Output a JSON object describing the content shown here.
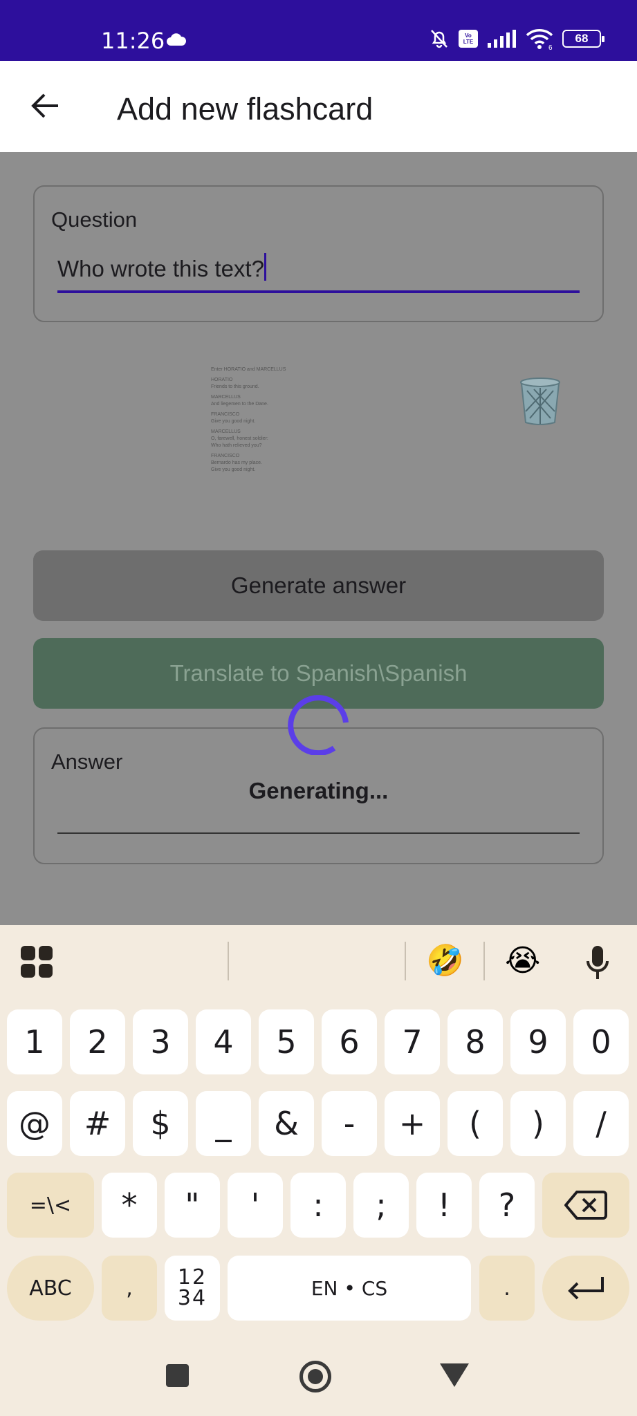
{
  "status_bar": {
    "time": "11:26",
    "battery": "68",
    "volte_line1": "Vo",
    "volte_line2": "LTE",
    "wifi_badge": "6"
  },
  "app_bar": {
    "title": "Add new flashcard"
  },
  "question": {
    "label": "Question",
    "value": "Who wrote this text?"
  },
  "attachment": {
    "lines": [
      "Enter HORATIO and MARCELLUS",
      "HORATIO",
      "Friends to this ground.",
      "MARCELLUS",
      "And liegemen to the Dane.",
      "FRANCISCO",
      "Give you good night.",
      "MARCELLUS",
      "O, farewell, honest soldier:",
      "Who hath relieved you?",
      "FRANCISCO",
      "Bernardo has my place.",
      "Give you good night."
    ]
  },
  "buttons": {
    "generate": "Generate answer",
    "translate": "Translate to Spanish\\Spanish"
  },
  "answer": {
    "label": "Answer",
    "value": ""
  },
  "loading": {
    "text": "Generating..."
  },
  "keyboard": {
    "suggestion_emojis": [
      "🤣",
      "😭"
    ],
    "row1": [
      "1",
      "2",
      "3",
      "4",
      "5",
      "6",
      "7",
      "8",
      "9",
      "0"
    ],
    "row2": [
      "@",
      "#",
      "$",
      "_",
      "&",
      "-",
      "+",
      "(",
      ")",
      "/"
    ],
    "row3": [
      "=\\<",
      "*",
      "\"",
      "'",
      ":",
      ";",
      "!",
      "?"
    ],
    "abc": "ABC",
    "comma": ",",
    "numpad_top": "12",
    "numpad_bottom": "34",
    "space": "EN • CS",
    "period": "."
  },
  "colors": {
    "status_bar": "#2d0f9c",
    "accent": "#2d0f9c",
    "spinner": "#5b3ee8",
    "translate_button": "#4e6b59",
    "keyboard_bg": "#f3ebdf",
    "function_key": "#f0e2c4"
  },
  "icons": {
    "back": "arrow-left-icon",
    "trash": "trash-can-icon",
    "keyboard_apps": "grid-icon",
    "mic": "microphone-icon",
    "backspace": "backspace-icon",
    "enter": "enter-icon"
  }
}
